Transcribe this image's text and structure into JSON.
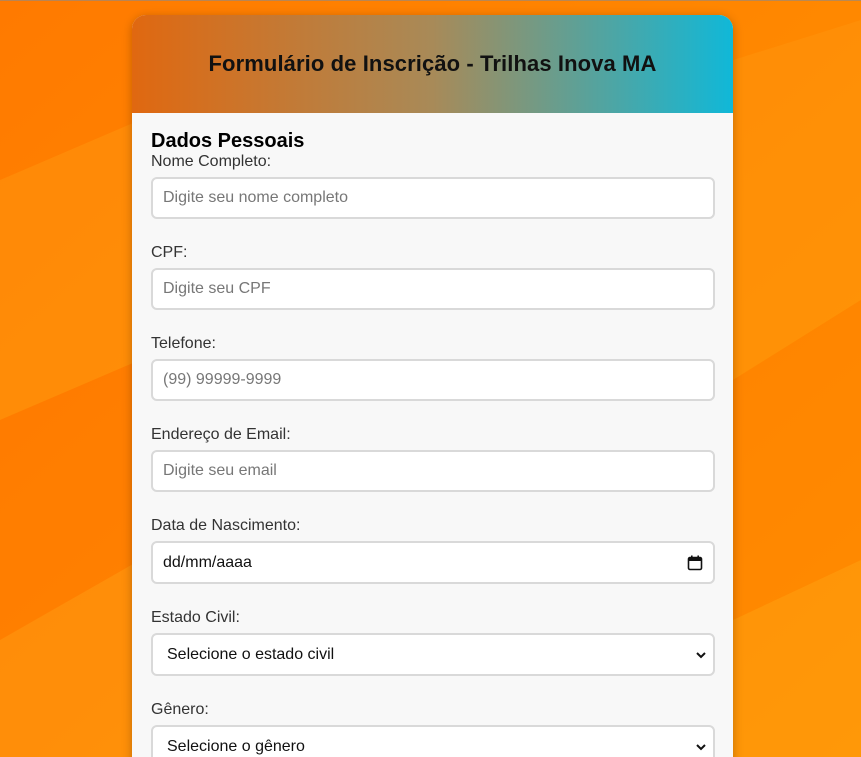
{
  "form": {
    "title": "Formulário de Inscrição - Trilhas Inova MA",
    "section_title": "Dados Pessoais",
    "fields": {
      "nome": {
        "label": "Nome Completo:",
        "placeholder": "Digite seu nome completo"
      },
      "cpf": {
        "label": "CPF:",
        "placeholder": "Digite seu CPF"
      },
      "telefone": {
        "label": "Telefone:",
        "placeholder": "(99) 99999-9999"
      },
      "email": {
        "label": "Endereço de Email:",
        "placeholder": "Digite seu email"
      },
      "nascimento": {
        "label": "Data de Nascimento:",
        "value": "dd/mm/aaaa",
        "icon": "calendar-icon"
      },
      "estado_civil": {
        "label": "Estado Civil:",
        "value": "Selecione o estado civil",
        "icon": "chevron-down-icon"
      },
      "genero": {
        "label": "Gênero:",
        "value": "Selecione o gênero",
        "icon": "chevron-down-icon"
      }
    }
  },
  "colors": {
    "background": "#ff8a00",
    "header_start": "#e06810",
    "header_end": "#10b8d8",
    "card": "#f8f8f8",
    "input_border": "#d9d9d9"
  }
}
